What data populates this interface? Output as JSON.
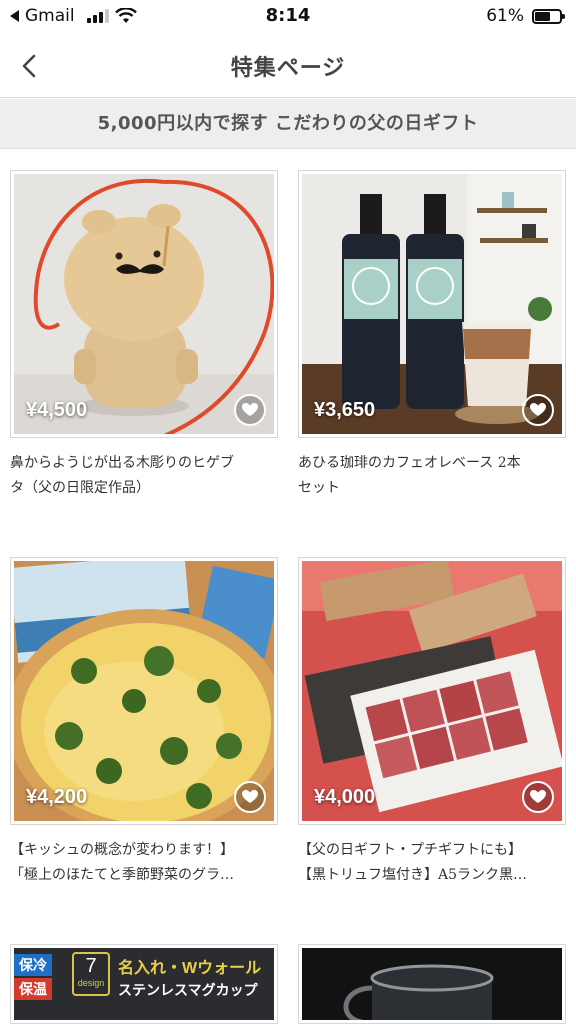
{
  "status_bar": {
    "back_app": "Gmail",
    "time": "8:14",
    "battery": "61%",
    "battery_level": 0.61
  },
  "nav": {
    "title": "特集ページ"
  },
  "banner": {
    "text": "5,000円以内で探す こだわりの父の日ギフト"
  },
  "products": [
    {
      "price": "¥4,500",
      "title_line1": "鼻からようじが出る木彫りのヒゲブ",
      "title_line2": "タ（父の日限定作品）"
    },
    {
      "price": "¥3,650",
      "title_line1": "あひる珈琲のカフェオレベース 2本",
      "title_line2": "セット"
    },
    {
      "price": "¥4,200",
      "title_line1": "【キッシュの概念が変わります！】",
      "title_line2": "「極上のほたてと季節野菜のグラ…"
    },
    {
      "price": "¥4,000",
      "title_line1": "【父の日ギフト・プチギフトにも】",
      "title_line2": "【黒トリュフ塩付き】A5ランク黒…"
    }
  ],
  "partial_card": {
    "badge_cold": "保冷",
    "badge_warm": "保温",
    "design_number": "7",
    "design_label": "design",
    "headline": "名入れ・Wウォール",
    "subline": "ステンレスマグカップ"
  }
}
